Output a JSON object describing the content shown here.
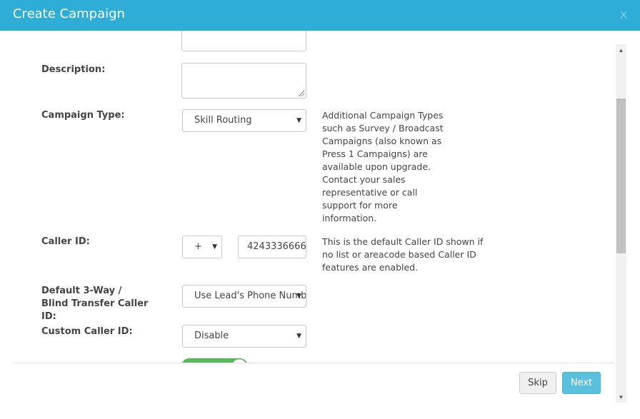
{
  "header": {
    "title": "Create Campaign",
    "close_label": "X"
  },
  "form": {
    "description": {
      "label": "Description:"
    },
    "campaign_type": {
      "label": "Campaign Type:",
      "value": "Skill Routing",
      "help": "Additional Campaign Types such as Survey / Broadcast Campaigns (also known as Press 1 Campaigns) are available upon upgrade. Contact your sales representative or call support for more information."
    },
    "caller_id": {
      "label": "Caller ID:",
      "country_code": "+",
      "number": "4243336666",
      "help": "This is the default Caller ID shown if no list or areacode based Caller ID features are enabled."
    },
    "transfer_caller_id": {
      "label": "Default 3-Way / Blind Transfer Caller ID:",
      "value": "Use Lead's Phone Number"
    },
    "custom_caller_id": {
      "label": "Custom Caller ID:",
      "value": "Disable"
    }
  },
  "footer": {
    "skip_label": "Skip",
    "next_label": "Next"
  },
  "icons": {
    "caret": "caret-down-icon",
    "scroll_up": "arrow-up-icon",
    "scroll_down": "arrow-down-icon"
  },
  "colors": {
    "header": "#2eaed6",
    "next_button": "#5bc0de",
    "toggle": "#5cb85c"
  }
}
